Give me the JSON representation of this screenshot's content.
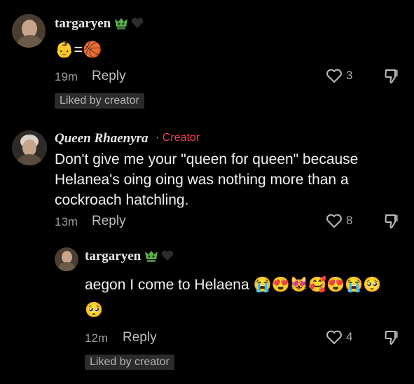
{
  "comments": [
    {
      "username": "targaryen",
      "text": "👶=🏀",
      "time": "19m",
      "reply_label": "Reply",
      "likes": "3",
      "liked_by": "Liked by creator"
    },
    {
      "username": "Queen Rhaenyra",
      "separator": "·",
      "creator_label": "Creator",
      "text": "Don't give me your \"queen for queen\" because Helanea's oing oing was nothing more than a cockroach hatchling.",
      "time": "13m",
      "reply_label": "Reply",
      "likes": "8"
    },
    {
      "username": "targaryen",
      "text": "aegon I come to Helaena 😭😍😻🥰😍😭🥺",
      "text_line2": "🥺",
      "time": "12m",
      "reply_label": "Reply",
      "likes": "4",
      "liked_by": "Liked by creator"
    }
  ],
  "colors": {
    "background": "#000000",
    "creator": "#ff3b5c",
    "chip_bg": "#2b2b2b"
  },
  "icons": [
    "dragon-badge-icon",
    "black-heart-icon",
    "heart-outline-icon",
    "dislike-icon"
  ]
}
